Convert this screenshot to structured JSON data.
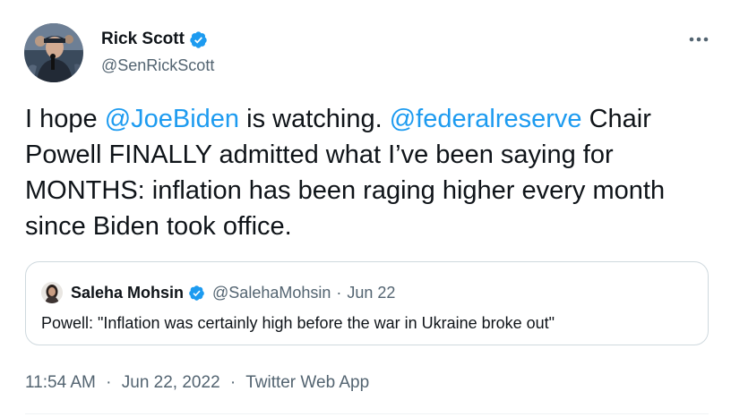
{
  "author": {
    "name": "Rick Scott",
    "handle": "@SenRickScott"
  },
  "tweet": {
    "text_1": "I hope ",
    "mention_1": "@JoeBiden",
    "text_2": " is watching. ",
    "mention_2": "@federalreserve",
    "text_3": " Chair Powell FINALLY admitted what I’ve been saying for MONTHS: inflation has been raging higher every month since Biden took office."
  },
  "quoted_tweet": {
    "name": "Saleha Mohsin",
    "handle": "@SalehaMohsin",
    "separator": "·",
    "date": "Jun 22",
    "text": "Powell: \"Inflation was certainly high before the war in Ukraine broke out\""
  },
  "meta": {
    "time": "11:54 AM",
    "dot_1": "·",
    "date": "Jun 22, 2022",
    "dot_2": "·",
    "source": "Twitter Web App"
  },
  "icons": {
    "verified": "verified-badge-icon",
    "more": "more-options-icon"
  },
  "colors": {
    "link": "#1d9bf0",
    "secondary_text": "#536471",
    "primary_text": "#0f1419",
    "border": "#cfd9de"
  }
}
